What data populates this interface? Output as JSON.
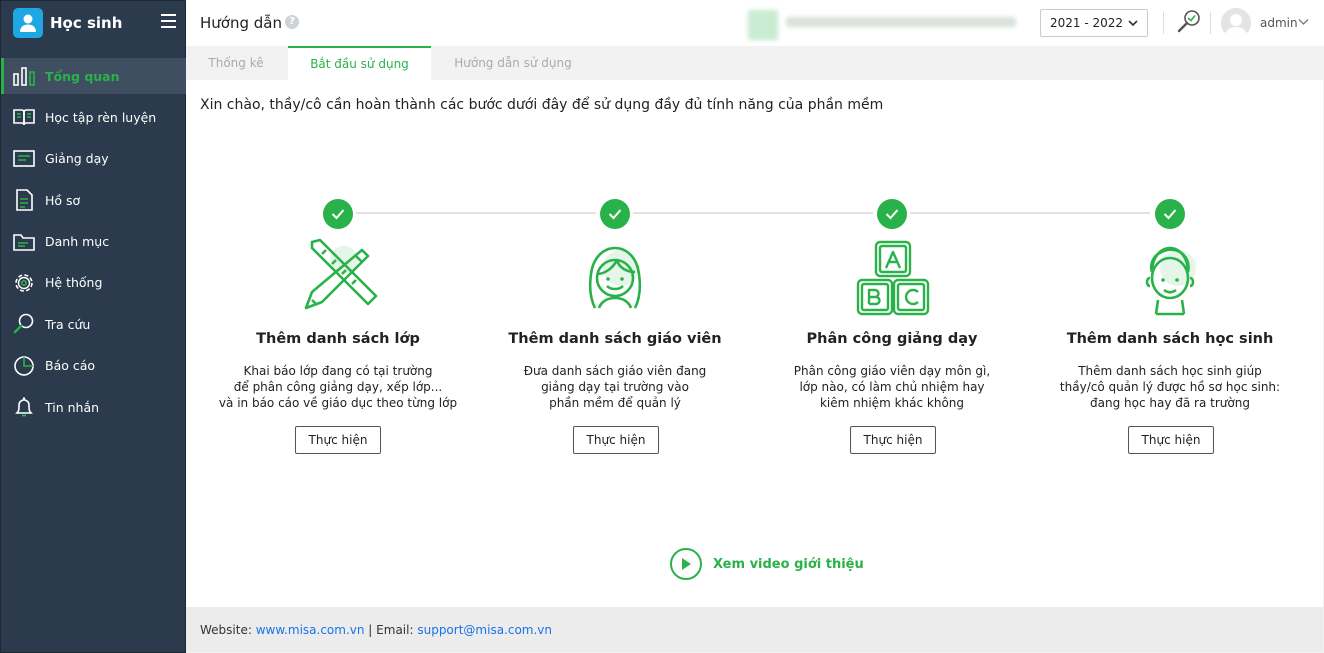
{
  "app": {
    "title": "Học sinh"
  },
  "sidebar": {
    "items": [
      {
        "label": "Tổng quan",
        "icon": "chart-bars-icon",
        "active": true
      },
      {
        "label": "Học tập rèn luyện",
        "icon": "book-icon"
      },
      {
        "label": "Giảng dạy",
        "icon": "board-icon"
      },
      {
        "label": "Hồ sơ",
        "icon": "document-icon"
      },
      {
        "label": "Danh mục",
        "icon": "folder-icon"
      },
      {
        "label": "Hệ thống",
        "icon": "gear-icon"
      },
      {
        "label": "Tra cứu",
        "icon": "search-icon"
      },
      {
        "label": "Báo cáo",
        "icon": "pie-chart-icon"
      },
      {
        "label": "Tin nhắn",
        "icon": "bell-icon"
      }
    ]
  },
  "header": {
    "title": "Hướng dẫn",
    "help": "?",
    "year": "2021 - 2022",
    "user": "admin"
  },
  "tabs": [
    {
      "label": "Thống kê",
      "active": false
    },
    {
      "label": "Bắt đầu sử dụng",
      "active": true
    },
    {
      "label": "Hướng dẫn sử dụng",
      "active": false
    }
  ],
  "intro": "Xin chào, thầy/cô cần hoàn thành các bước dưới đây để sử dụng đầy đủ tính năng của phần mềm",
  "steps": [
    {
      "title": "Thêm danh sách lớp",
      "desc": [
        "Khai báo lớp đang có tại trường",
        "để phân công giảng dạy, xếp lớp...",
        "và in báo cáo về giáo dục theo từng lớp"
      ],
      "button": "Thực hiện",
      "completed": true,
      "icon": "ruler-pencil-icon"
    },
    {
      "title": "Thêm danh sách giáo viên",
      "desc": [
        "Đưa danh sách giáo viên đang",
        "giảng dạy tại trường vào",
        "phần mềm để quản lý"
      ],
      "button": "Thực hiện",
      "completed": true,
      "icon": "teacher-icon"
    },
    {
      "title": "Phân công giảng dạy",
      "desc": [
        "Phân công giáo viên dạy môn gì,",
        "lớp nào, có làm chủ nhiệm hay",
        "kiêm nhiệm khác không"
      ],
      "button": "Thực hiện",
      "completed": true,
      "icon": "abc-blocks-icon"
    },
    {
      "title": "Thêm danh sách học sinh",
      "desc": [
        "Thêm danh sách học sinh giúp",
        "thầy/cô quản lý được hồ sơ học sinh:",
        "đang học hay đã ra trường"
      ],
      "button": "Thực hiện",
      "completed": true,
      "icon": "student-icon"
    }
  ],
  "video": {
    "label": "Xem video giới thiệu"
  },
  "footer": {
    "website_label": "Website:",
    "website": "www.misa.com.vn",
    "divider": "|",
    "email_label": "Email:",
    "email": "support@misa.com.vn"
  },
  "colors": {
    "accent": "#2ab24a",
    "sidebar": "#2b3a4d",
    "link": "#1a73e8"
  }
}
